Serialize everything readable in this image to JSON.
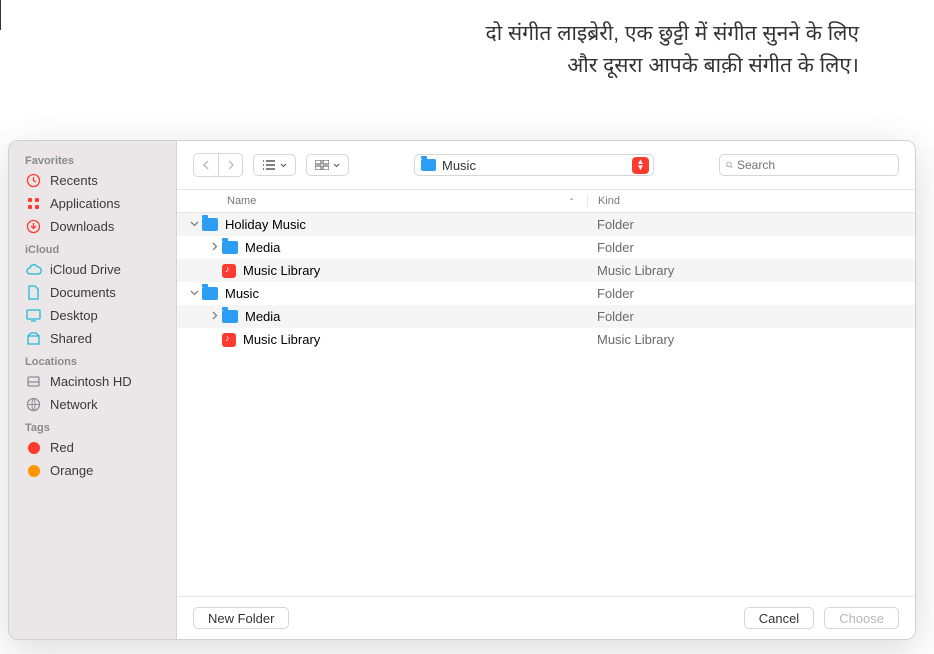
{
  "annotation": {
    "text": "दो संगीत लाइब्रेरी, एक छुट्टी में संगीत सुनने के लिए और दूसरा आपके बाक़ी संगीत के लिए।"
  },
  "sidebar": {
    "sections": [
      {
        "title": "Favorites",
        "items": [
          {
            "label": "Recents",
            "icon": "clock-icon",
            "color": "#ff3b30"
          },
          {
            "label": "Applications",
            "icon": "grid-icon",
            "color": "#ff3b30"
          },
          {
            "label": "Downloads",
            "icon": "download-icon",
            "color": "#ff3b30"
          }
        ]
      },
      {
        "title": "iCloud",
        "items": [
          {
            "label": "iCloud Drive",
            "icon": "cloud-icon",
            "color": "#1fbad6"
          },
          {
            "label": "Documents",
            "icon": "doc-icon",
            "color": "#1fbad6"
          },
          {
            "label": "Desktop",
            "icon": "desktop-icon",
            "color": "#1fbad6"
          },
          {
            "label": "Shared",
            "icon": "shared-icon",
            "color": "#1fbad6"
          }
        ]
      },
      {
        "title": "Locations",
        "items": [
          {
            "label": "Macintosh HD",
            "icon": "disk-icon",
            "color": "#8e8e93"
          },
          {
            "label": "Network",
            "icon": "globe-icon",
            "color": "#8e8e93"
          }
        ]
      },
      {
        "title": "Tags",
        "items": [
          {
            "label": "Red",
            "icon": "tag-dot",
            "color": "#ff3b30"
          },
          {
            "label": "Orange",
            "icon": "tag-dot",
            "color": "#ff9500"
          }
        ]
      }
    ]
  },
  "toolbar": {
    "path_label": "Music",
    "search_placeholder": "Search"
  },
  "columns": {
    "name": "Name",
    "kind": "Kind"
  },
  "rows": [
    {
      "indent": 0,
      "disclosure": "open",
      "icon": "folder",
      "name": "Holiday Music",
      "kind": "Folder"
    },
    {
      "indent": 1,
      "disclosure": "closed",
      "icon": "folder",
      "name": "Media",
      "kind": "Folder"
    },
    {
      "indent": 1,
      "disclosure": "none",
      "icon": "library",
      "name": "Music Library",
      "kind": "Music Library"
    },
    {
      "indent": 0,
      "disclosure": "open",
      "icon": "folder",
      "name": "Music",
      "kind": "Folder"
    },
    {
      "indent": 1,
      "disclosure": "closed",
      "icon": "folder",
      "name": "Media",
      "kind": "Folder"
    },
    {
      "indent": 1,
      "disclosure": "none",
      "icon": "library",
      "name": "Music Library",
      "kind": "Music Library"
    }
  ],
  "footer": {
    "new_folder": "New Folder",
    "cancel": "Cancel",
    "choose": "Choose"
  }
}
